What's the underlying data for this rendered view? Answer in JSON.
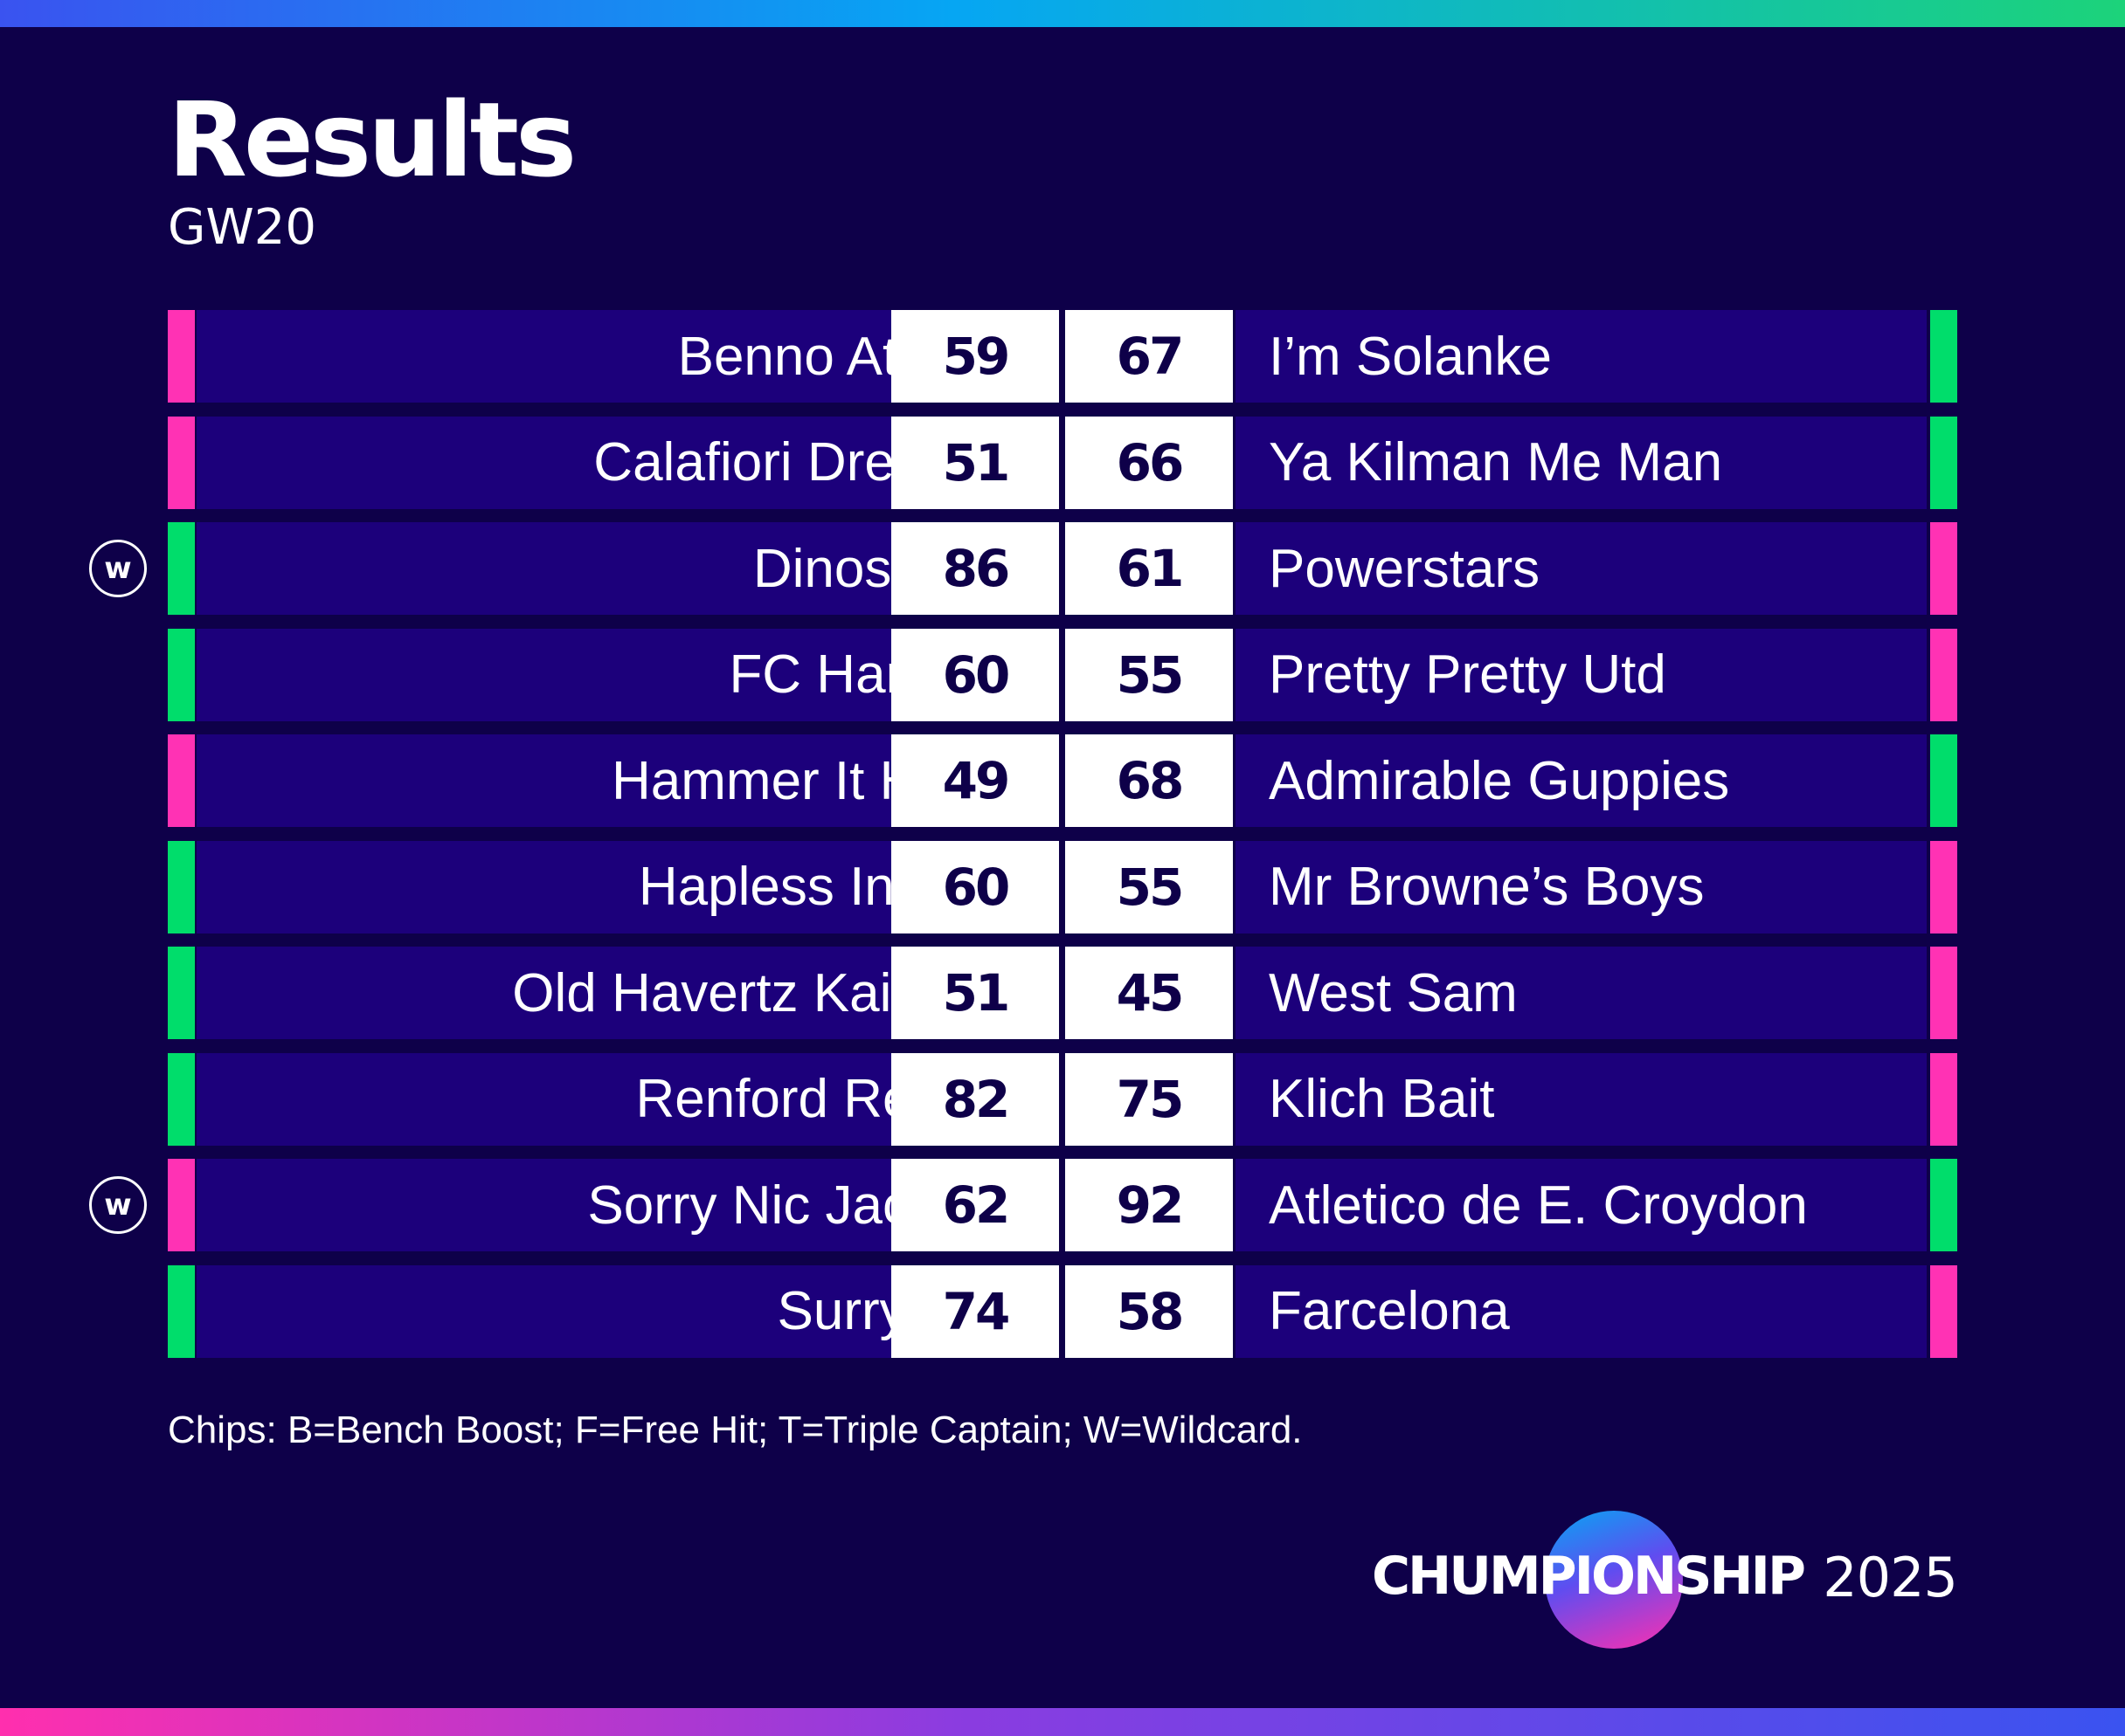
{
  "header": {
    "title": "Results",
    "subtitle": "GW20"
  },
  "colors": {
    "background": "#0e0049",
    "row_fill": "#1c007b",
    "win": "#00dd6b",
    "loss": "#ff32b4"
  },
  "matches": [
    {
      "home": "Benno Athletic",
      "home_score": "59",
      "away_score": "67",
      "away": "I’m Solanke",
      "home_chip": ""
    },
    {
      "home": "Calafiori Dreamin’",
      "home_score": "51",
      "away_score": "66",
      "away": "Ya Kilman Me Man",
      "home_chip": ""
    },
    {
      "home": "Dinoscores",
      "home_score": "86",
      "away_score": "61",
      "away": "Powerstars",
      "home_chip": "W"
    },
    {
      "home": "FC Hammer",
      "home_score": "60",
      "away_score": "55",
      "away": "Pretty Pretty Utd",
      "home_chip": ""
    },
    {
      "home": "Hammer It Home",
      "home_score": "49",
      "away_score": "68",
      "away": "Admirable Guppies",
      "home_chip": ""
    },
    {
      "home": "Hapless Ingles?",
      "home_score": "60",
      "away_score": "55",
      "away": "Mr Browne’s Boys",
      "home_chip": ""
    },
    {
      "home": "Old Havertz Kai Hard",
      "home_score": "51",
      "away_score": "45",
      "away": "West Sam",
      "home_chip": ""
    },
    {
      "home": "Renford Rejects",
      "home_score": "82",
      "away_score": "75",
      "away": "Klich Bait",
      "home_chip": ""
    },
    {
      "home": "Sorry Nic Jackson",
      "home_score": "62",
      "away_score": "92",
      "away": "Atletico de E. Croydon",
      "home_chip": "W"
    },
    {
      "home": "Surry Hills",
      "home_score": "74",
      "away_score": "58",
      "away": "Farcelona",
      "home_chip": ""
    }
  ],
  "footnote": "Chips: B=Bench Boost; F=Free Hit; T=Triple Captain; W=Wildcard.",
  "brand": {
    "name": "CHUMPIONSHIP",
    "year": "2025"
  }
}
